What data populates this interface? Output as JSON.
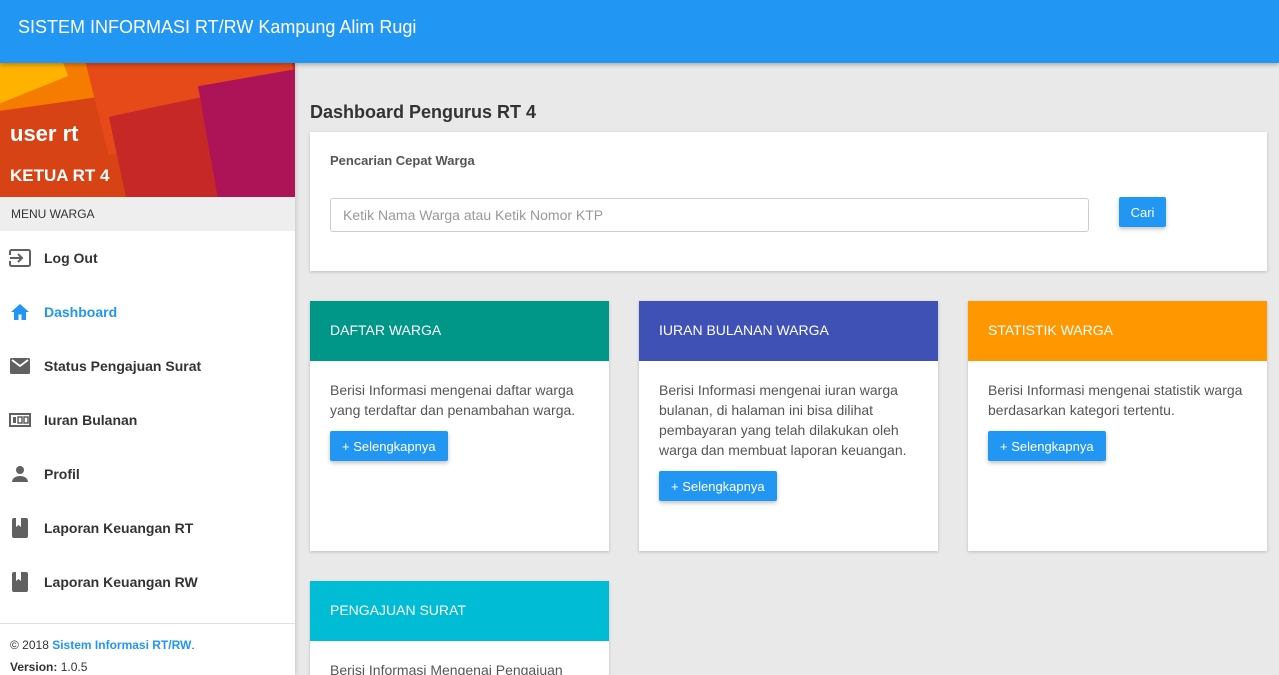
{
  "header": {
    "title": "SISTEM INFORMASI RT/RW Kampung Alim Rugi"
  },
  "sidebar": {
    "user_name": "user rt",
    "user_role": "KETUA RT 4",
    "menu_header": "MENU WARGA",
    "items": [
      {
        "label": "Log Out",
        "icon": "logout-icon"
      },
      {
        "label": "Dashboard",
        "icon": "home-icon",
        "active": true
      },
      {
        "label": "Status Pengajuan Surat",
        "icon": "mail-icon"
      },
      {
        "label": "Iuran Bulanan",
        "icon": "counter-icon"
      },
      {
        "label": "Profil",
        "icon": "person-icon"
      },
      {
        "label": "Laporan Keuangan RT",
        "icon": "book-icon"
      },
      {
        "label": "Laporan Keuangan RW",
        "icon": "book-icon"
      }
    ],
    "footer": {
      "copyright_prefix": "© 2018 ",
      "link": "Sistem Informasi RT/RW",
      "suffix": ".",
      "version_label": "Version:",
      "version": " 1.0.5"
    }
  },
  "main": {
    "page_title": "Dashboard Pengurus RT 4",
    "search": {
      "label": "Pencarian Cepat Warga",
      "placeholder": "Ketik Nama Warga atau Ketik Nomor KTP",
      "value": "",
      "button": "Cari"
    },
    "cards": [
      {
        "title": "DAFTAR WARGA",
        "color": "#009688",
        "text": "Berisi Informasi mengenai daftar warga yang terdaftar dan penambahan warga.",
        "button": "+ Selengkapnya"
      },
      {
        "title": "IURAN BULANAN WARGA",
        "color": "#3f51b5",
        "text": "Berisi Informasi mengenai iuran warga bulanan, di halaman ini bisa dilihat pembayaran yang telah dilakukan oleh warga dan membuat laporan keuangan.",
        "button": "+ Selengkapnya"
      },
      {
        "title": "STATISTIK WARGA",
        "color": "#ff9800",
        "text": "Berisi Informasi mengenai statistik warga berdasarkan kategori tertentu.",
        "button": "+ Selengkapnya"
      },
      {
        "title": "PENGAJUAN SURAT",
        "color": "#00bcd4",
        "text": "Berisi Informasi Mengenai Pengajuan",
        "button": ""
      }
    ]
  },
  "colors": {
    "primary": "#2196f3",
    "sidebar_active": "#2196f3"
  }
}
